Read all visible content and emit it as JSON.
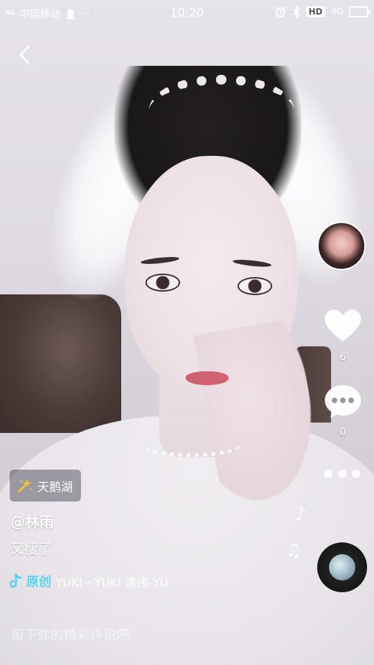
{
  "statusbar": {
    "signal_label": "4G",
    "carrier": "中国移动",
    "more_dots": "···",
    "time": "10:20",
    "hd_label": "HD",
    "network": "4G"
  },
  "location": {
    "label": "天鹅湖"
  },
  "post": {
    "username": "@林雨",
    "caption": "又瘦了"
  },
  "music": {
    "tag": "原创",
    "text": "YUKI－YUKI    清浅-YU"
  },
  "actions": {
    "like_count": "6",
    "comment_count": "0"
  },
  "comment_box": {
    "placeholder": "留下你的精彩评论吧"
  },
  "colors": {
    "accent_music": "#5ad3ef",
    "text": "#ffffff"
  },
  "icons": [
    "back-arrow-icon",
    "heart-icon",
    "comment-bubble-icon",
    "more-dots-icon",
    "music-note-icon",
    "sparkle-location-icon",
    "alarm-icon",
    "bluetooth-icon",
    "battery-icon",
    "qq-icon"
  ]
}
